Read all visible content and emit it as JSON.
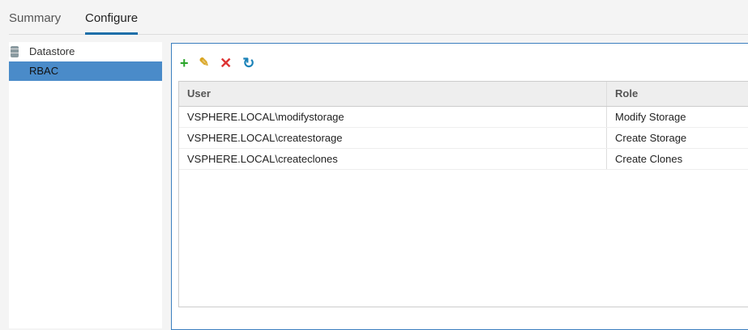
{
  "tabs": [
    {
      "label": "Summary"
    },
    {
      "label": "Configure",
      "active": true
    }
  ],
  "sidebar": {
    "items": [
      {
        "label": "Datastore",
        "icon": "database-icon"
      },
      {
        "label": "RBAC",
        "selected": true
      }
    ]
  },
  "toolbar": {
    "icons": [
      "add-icon",
      "edit-icon",
      "delete-icon",
      "refresh-icon"
    ]
  },
  "table": {
    "columns": [
      "User",
      "Role"
    ],
    "rows": [
      [
        "VSPHERE.LOCAL\\modifystorage",
        "Modify Storage"
      ],
      [
        "VSPHERE.LOCAL\\createstorage",
        "Create Storage"
      ],
      [
        "VSPHERE.LOCAL\\createclones",
        "Create Clones"
      ]
    ]
  }
}
